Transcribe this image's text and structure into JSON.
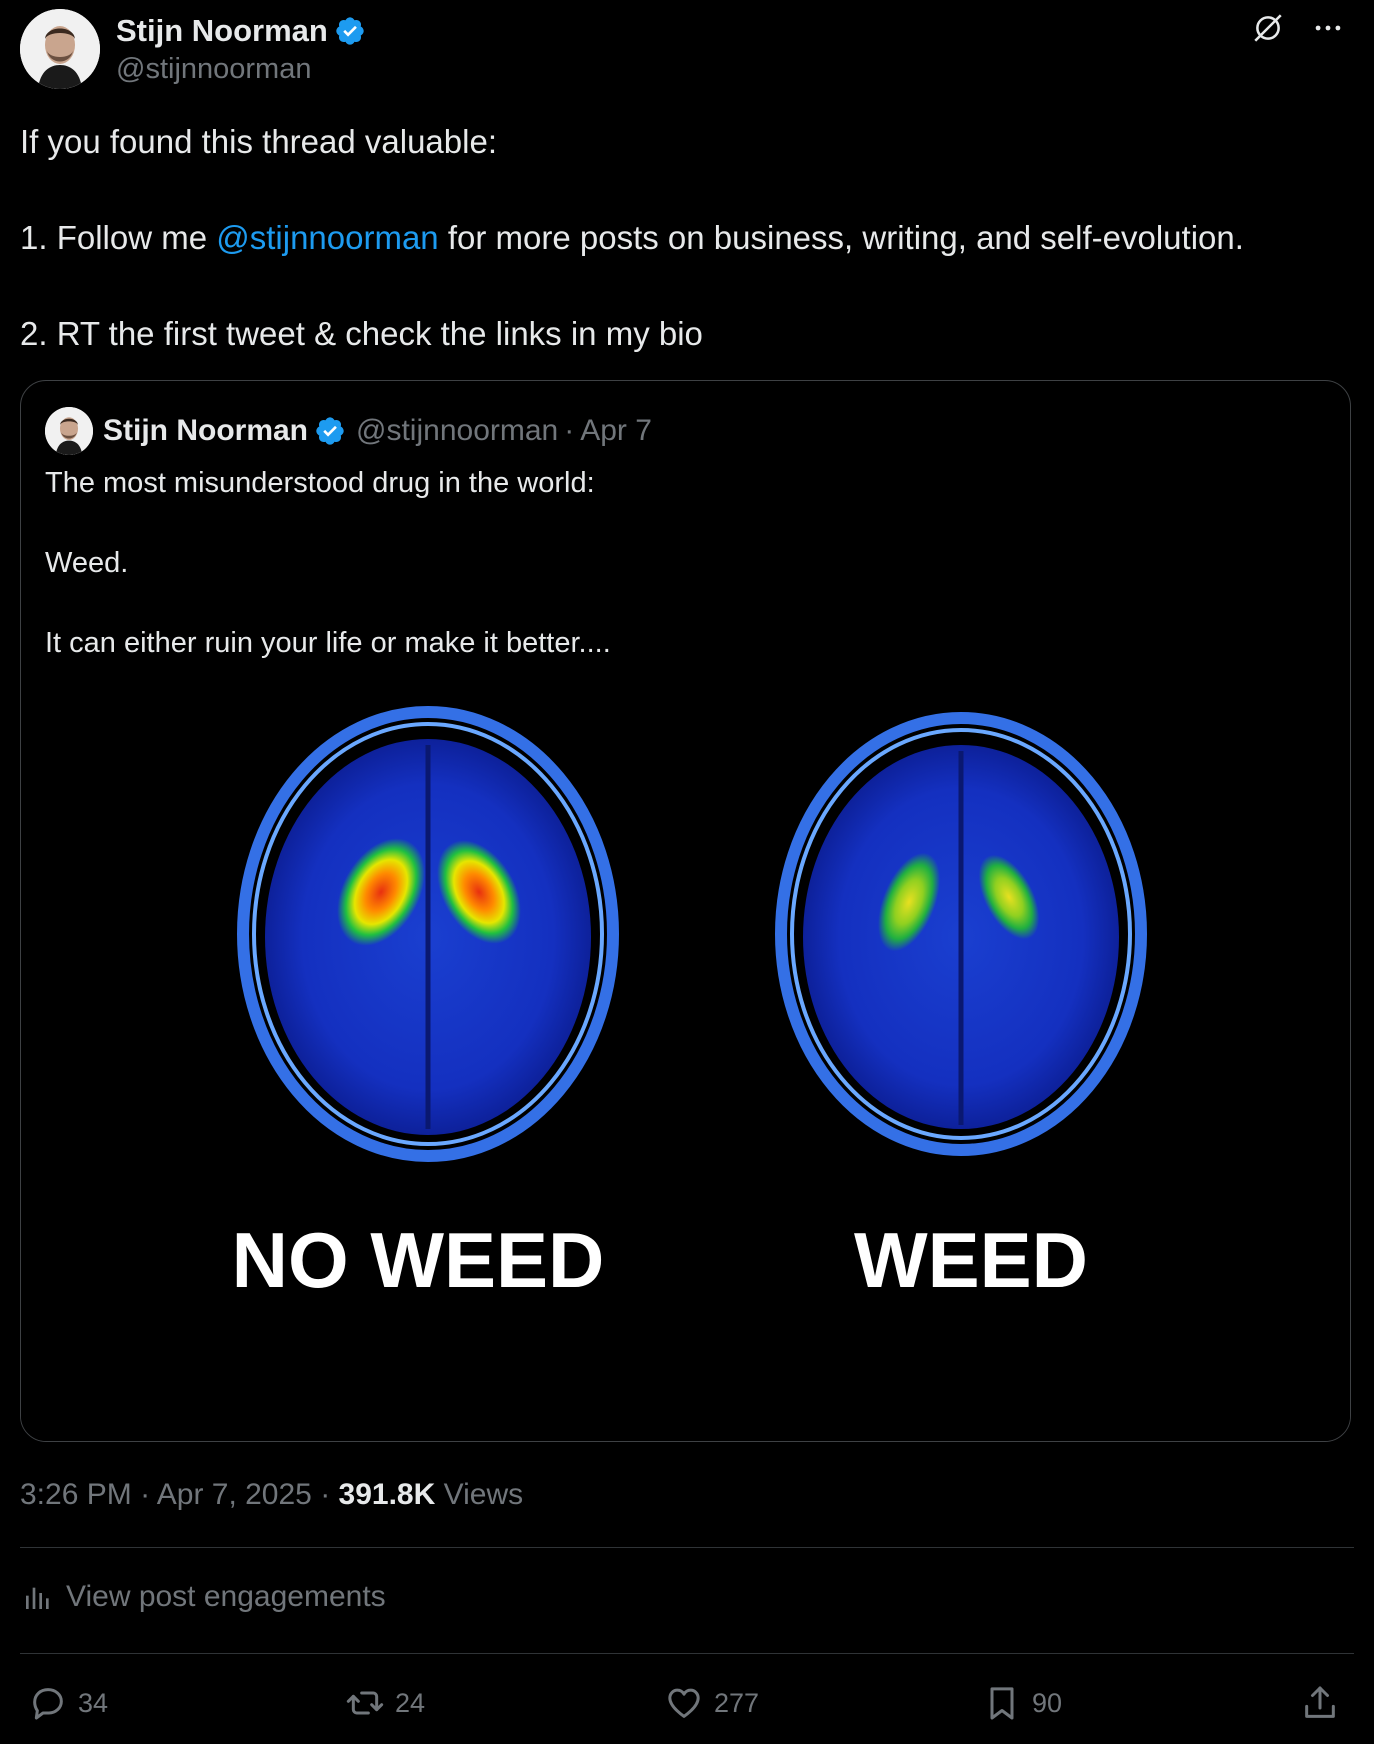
{
  "author": {
    "name": "Stijn Noorman",
    "handle": "@stijnnoorman"
  },
  "tweet": {
    "line1": "If you found this thread valuable:",
    "line2_prefix": "1. Follow me ",
    "line2_mention": "@stijnnoorman",
    "line2_suffix": " for more posts on business, writing, and self-evolution.",
    "line3": "2. RT the first tweet & check the links in my bio"
  },
  "quote": {
    "name": "Stijn Noorman",
    "handle": "@stijnnoorman",
    "separator": "·",
    "date": "Apr 7",
    "line1": "The most misunderstood drug in the world:",
    "line2": "Weed.",
    "line3": "It can either ruin your life or make it better....",
    "image": {
      "left_label": "NO WEED",
      "right_label": "WEED"
    }
  },
  "meta": {
    "time": "3:26 PM",
    "sep1": " · ",
    "date": "Apr 7, 2025",
    "sep2": " · ",
    "views_count": "391.8K",
    "views_label": " Views"
  },
  "engagements_label": "View post engagements",
  "actions": {
    "replies": "34",
    "reposts": "24",
    "likes": "277",
    "bookmarks": "90"
  },
  "colors": {
    "background": "#000000",
    "text": "#e7e9ea",
    "secondary": "#71767b",
    "accent": "#1d9bf0",
    "border": "#2f3336"
  },
  "icons": [
    "verified-badge-icon",
    "grok-icon",
    "more-icon",
    "analytics-icon",
    "reply-icon",
    "repost-icon",
    "like-icon",
    "bookmark-icon",
    "share-icon"
  ]
}
